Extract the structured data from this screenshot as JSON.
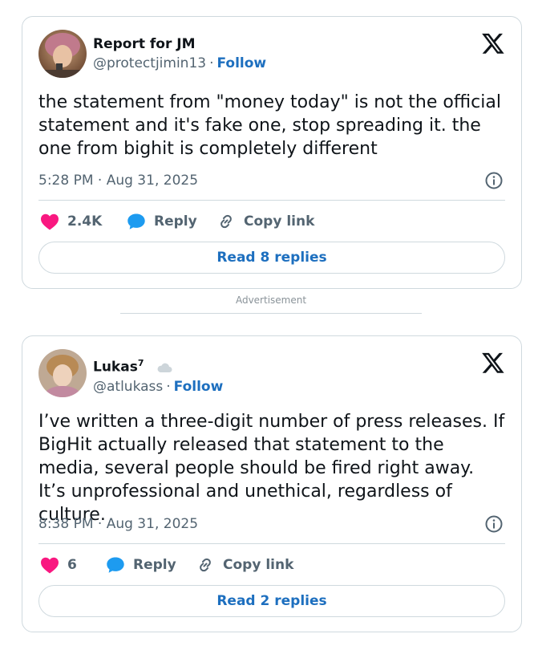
{
  "advertisement": "Advertisement",
  "tweets": [
    {
      "display_name": "Report for JM",
      "handle": "@protectjimin13",
      "follow_label": "Follow",
      "text": "the statement from \"money today\" is not the official statement and it's fake one, stop spreading it. the one from bighit is completely different",
      "timestamp": "5:28 PM · Aug 31, 2025",
      "likes": "2.4K",
      "reply_label": "Reply",
      "copy_label": "Copy link",
      "read_replies": "Read 8 replies"
    },
    {
      "display_name": "Lukas",
      "name_superscript": "7",
      "handle": "@atlukass",
      "follow_label": "Follow",
      "text": "I’ve written a three-digit number of press releases. If BigHit actually released that statement to the media, several people should be fired right away. It’s unprofessional and unethical, regardless of culture.",
      "timestamp": "8:38 PM · Aug 31, 2025",
      "likes": "6",
      "reply_label": "Reply",
      "copy_label": "Copy link",
      "read_replies": "Read 2 replies"
    }
  ],
  "icons": {
    "x_logo": "x-logo-icon",
    "info": "info-icon",
    "heart": "heart-icon",
    "reply": "reply-bubble-icon",
    "link": "link-icon",
    "badge": "cloud-icon"
  },
  "colors": {
    "heart": "#f91880",
    "reply": "#1d9bf0",
    "follow": "#1d6fbf",
    "border": "#cfd9de",
    "muted": "#536471"
  }
}
